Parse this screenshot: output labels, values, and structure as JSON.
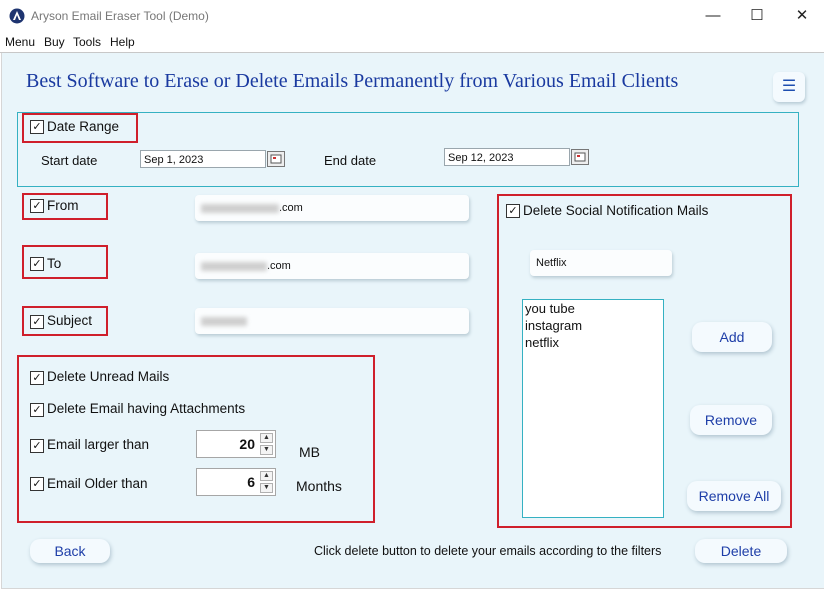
{
  "window": {
    "title": "Aryson Email Eraser Tool (Demo)",
    "controls": {
      "minimize": "—",
      "maximize": "☐",
      "close": "✕"
    }
  },
  "menubar": [
    "Menu",
    "Buy",
    "Tools",
    "Help"
  ],
  "headline": "Best Software to Erase or Delete Emails Permanently from Various Email Clients",
  "date_range": {
    "label": "Date Range",
    "start_label": "Start date",
    "start_value": "Sep 1, 2023",
    "end_label": "End date",
    "end_value": "Sep 12, 2023"
  },
  "filters": {
    "from_label": "From",
    "from_suffix": ".com",
    "to_label": "To",
    "to_suffix": ".com",
    "subject_label": "Subject"
  },
  "options": {
    "unread": "Delete Unread Mails",
    "attachments": "Delete Email having Attachments",
    "larger_label": "Email larger than",
    "larger_value": "20",
    "larger_unit": "MB",
    "older_label": "Email Older than",
    "older_value": "6",
    "older_unit": "Months"
  },
  "social": {
    "label": "Delete Social Notification Mails",
    "input_value": "Netflix",
    "list": [
      "you tube",
      "instagram",
      "netflix"
    ],
    "add_label": "Add",
    "remove_label": "Remove",
    "remove_all_label": "Remove All"
  },
  "footer": {
    "back_label": "Back",
    "hint": "Click delete button to delete your emails according to the filters",
    "delete_label": "Delete"
  },
  "colors": {
    "accent_blue": "#1a3aa0",
    "highlight_red": "#cf1f2b",
    "panel_bg": "#e9f5fa",
    "teal_border": "#35b1c2"
  }
}
